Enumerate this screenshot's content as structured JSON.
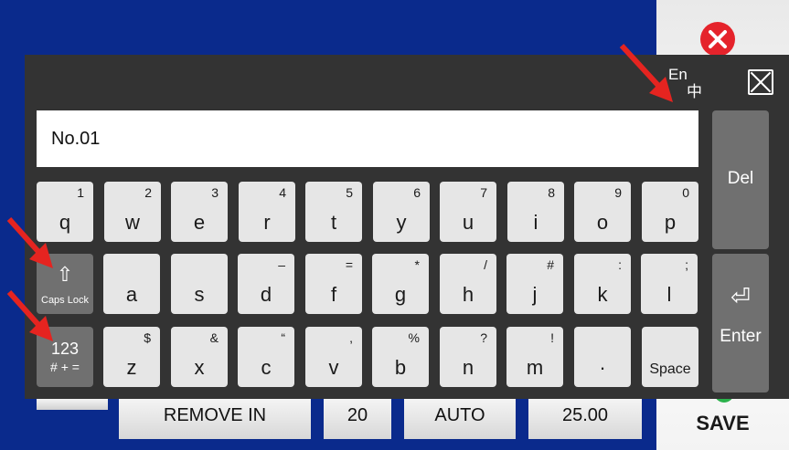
{
  "background": {
    "cells": [
      "REMOVE IN",
      "20",
      "AUTO",
      "25.00"
    ],
    "save_label": "SAVE",
    "close_icon": "close-circle-icon"
  },
  "keyboard": {
    "lang": {
      "primary": "En",
      "secondary": "中"
    },
    "close_icon": "close-box-icon",
    "input_value": "No.01",
    "row1": [
      {
        "main": "q",
        "sup": "1"
      },
      {
        "main": "w",
        "sup": "2"
      },
      {
        "main": "e",
        "sup": "3"
      },
      {
        "main": "r",
        "sup": "4"
      },
      {
        "main": "t",
        "sup": "5"
      },
      {
        "main": "y",
        "sup": "6"
      },
      {
        "main": "u",
        "sup": "7"
      },
      {
        "main": "i",
        "sup": "8"
      },
      {
        "main": "o",
        "sup": "9"
      },
      {
        "main": "p",
        "sup": "0"
      }
    ],
    "row2": [
      {
        "main": "a",
        "sup": ""
      },
      {
        "main": "s",
        "sup": ""
      },
      {
        "main": "d",
        "sup": "–"
      },
      {
        "main": "f",
        "sup": "="
      },
      {
        "main": "g",
        "sup": "*"
      },
      {
        "main": "h",
        "sup": "/"
      },
      {
        "main": "j",
        "sup": "#"
      },
      {
        "main": "k",
        "sup": ":"
      },
      {
        "main": "l",
        "sup": ";"
      }
    ],
    "row3": [
      {
        "main": "z",
        "sup": "$"
      },
      {
        "main": "x",
        "sup": "&"
      },
      {
        "main": "c",
        "sup": "“"
      },
      {
        "main": "v",
        "sup": ","
      },
      {
        "main": "b",
        "sup": "%"
      },
      {
        "main": "n",
        "sup": "?"
      },
      {
        "main": "m",
        "sup": "!"
      },
      {
        "main": "·",
        "sup": ""
      }
    ],
    "caps": {
      "glyph": "⇧",
      "label": "Caps Lock"
    },
    "num": {
      "line1": "123",
      "line2": "# + ="
    },
    "space_label": "Space",
    "del_label": "Del",
    "enter": {
      "glyph": "⏎",
      "label": "Enter"
    }
  },
  "annotations": {
    "arrow_color": "#e52420"
  }
}
